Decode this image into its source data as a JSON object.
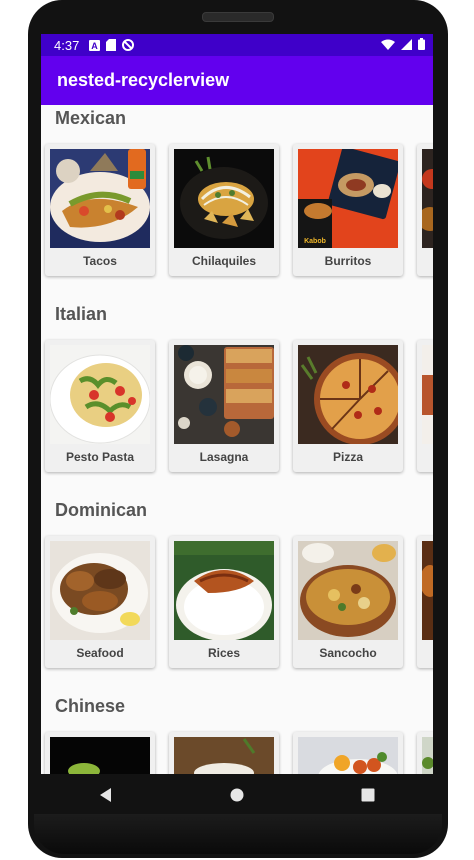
{
  "status": {
    "time": "4:37"
  },
  "app": {
    "title": "nested-recyclerview"
  },
  "sections": [
    {
      "title": "Mexican",
      "items": [
        "Tacos",
        "Chilaquiles",
        "Burritos",
        ""
      ]
    },
    {
      "title": "Italian",
      "items": [
        "Pesto Pasta",
        "Lasagna",
        "Pizza",
        ""
      ]
    },
    {
      "title": "Dominican",
      "items": [
        "Seafood",
        "Rices",
        "Sancocho",
        ""
      ]
    },
    {
      "title": "Chinese",
      "items": [
        "",
        "",
        "",
        ""
      ]
    }
  ],
  "colors": {
    "status_bar": "#3f00c9",
    "app_bar": "#6200ee",
    "background": "#fafafa"
  },
  "icons": [
    "a-icon",
    "sd-card-icon",
    "do-not-disturb-icon",
    "wifi-icon",
    "signal-icon",
    "battery-icon",
    "back-icon",
    "home-icon",
    "recents-icon"
  ]
}
